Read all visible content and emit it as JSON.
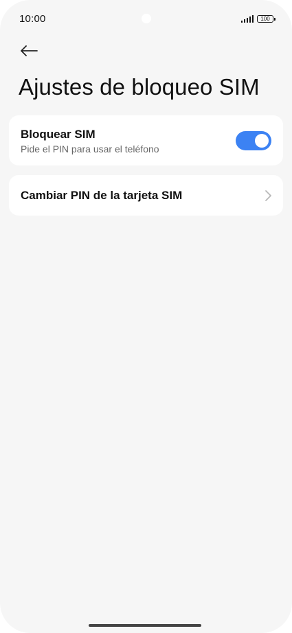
{
  "status_bar": {
    "time": "10:00",
    "battery_level": "100",
    "signal_icon": "signal-bars-icon"
  },
  "header": {
    "back_icon": "arrow-left-icon",
    "title": "Ajustes de bloqueo SIM"
  },
  "settings": {
    "lock_sim": {
      "title": "Bloquear SIM",
      "subtitle": "Pide el PIN para usar el teléfono",
      "enabled": true
    },
    "change_pin": {
      "title": "Cambiar PIN de la tarjeta SIM",
      "icon": "chevron-right-icon"
    }
  },
  "colors": {
    "accent": "#3c82f3",
    "background": "#f6f6f6",
    "card": "#ffffff"
  }
}
